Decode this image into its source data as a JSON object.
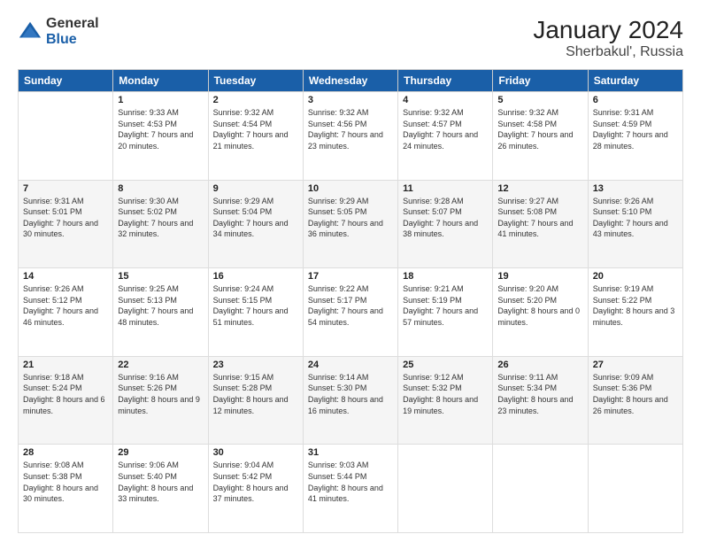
{
  "logo": {
    "general": "General",
    "blue": "Blue"
  },
  "header": {
    "title": "January 2024",
    "subtitle": "Sherbakul', Russia"
  },
  "weekdays": [
    "Sunday",
    "Monday",
    "Tuesday",
    "Wednesday",
    "Thursday",
    "Friday",
    "Saturday"
  ],
  "weeks": [
    [
      {
        "day": "",
        "sunrise": "",
        "sunset": "",
        "daylight": ""
      },
      {
        "day": "1",
        "sunrise": "9:33 AM",
        "sunset": "4:53 PM",
        "daylight": "7 hours and 20 minutes."
      },
      {
        "day": "2",
        "sunrise": "9:32 AM",
        "sunset": "4:54 PM",
        "daylight": "7 hours and 21 minutes."
      },
      {
        "day": "3",
        "sunrise": "9:32 AM",
        "sunset": "4:56 PM",
        "daylight": "7 hours and 23 minutes."
      },
      {
        "day": "4",
        "sunrise": "9:32 AM",
        "sunset": "4:57 PM",
        "daylight": "7 hours and 24 minutes."
      },
      {
        "day": "5",
        "sunrise": "9:32 AM",
        "sunset": "4:58 PM",
        "daylight": "7 hours and 26 minutes."
      },
      {
        "day": "6",
        "sunrise": "9:31 AM",
        "sunset": "4:59 PM",
        "daylight": "7 hours and 28 minutes."
      }
    ],
    [
      {
        "day": "7",
        "sunrise": "9:31 AM",
        "sunset": "5:01 PM",
        "daylight": "7 hours and 30 minutes."
      },
      {
        "day": "8",
        "sunrise": "9:30 AM",
        "sunset": "5:02 PM",
        "daylight": "7 hours and 32 minutes."
      },
      {
        "day": "9",
        "sunrise": "9:29 AM",
        "sunset": "5:04 PM",
        "daylight": "7 hours and 34 minutes."
      },
      {
        "day": "10",
        "sunrise": "9:29 AM",
        "sunset": "5:05 PM",
        "daylight": "7 hours and 36 minutes."
      },
      {
        "day": "11",
        "sunrise": "9:28 AM",
        "sunset": "5:07 PM",
        "daylight": "7 hours and 38 minutes."
      },
      {
        "day": "12",
        "sunrise": "9:27 AM",
        "sunset": "5:08 PM",
        "daylight": "7 hours and 41 minutes."
      },
      {
        "day": "13",
        "sunrise": "9:26 AM",
        "sunset": "5:10 PM",
        "daylight": "7 hours and 43 minutes."
      }
    ],
    [
      {
        "day": "14",
        "sunrise": "9:26 AM",
        "sunset": "5:12 PM",
        "daylight": "7 hours and 46 minutes."
      },
      {
        "day": "15",
        "sunrise": "9:25 AM",
        "sunset": "5:13 PM",
        "daylight": "7 hours and 48 minutes."
      },
      {
        "day": "16",
        "sunrise": "9:24 AM",
        "sunset": "5:15 PM",
        "daylight": "7 hours and 51 minutes."
      },
      {
        "day": "17",
        "sunrise": "9:22 AM",
        "sunset": "5:17 PM",
        "daylight": "7 hours and 54 minutes."
      },
      {
        "day": "18",
        "sunrise": "9:21 AM",
        "sunset": "5:19 PM",
        "daylight": "7 hours and 57 minutes."
      },
      {
        "day": "19",
        "sunrise": "9:20 AM",
        "sunset": "5:20 PM",
        "daylight": "8 hours and 0 minutes."
      },
      {
        "day": "20",
        "sunrise": "9:19 AM",
        "sunset": "5:22 PM",
        "daylight": "8 hours and 3 minutes."
      }
    ],
    [
      {
        "day": "21",
        "sunrise": "9:18 AM",
        "sunset": "5:24 PM",
        "daylight": "8 hours and 6 minutes."
      },
      {
        "day": "22",
        "sunrise": "9:16 AM",
        "sunset": "5:26 PM",
        "daylight": "8 hours and 9 minutes."
      },
      {
        "day": "23",
        "sunrise": "9:15 AM",
        "sunset": "5:28 PM",
        "daylight": "8 hours and 12 minutes."
      },
      {
        "day": "24",
        "sunrise": "9:14 AM",
        "sunset": "5:30 PM",
        "daylight": "8 hours and 16 minutes."
      },
      {
        "day": "25",
        "sunrise": "9:12 AM",
        "sunset": "5:32 PM",
        "daylight": "8 hours and 19 minutes."
      },
      {
        "day": "26",
        "sunrise": "9:11 AM",
        "sunset": "5:34 PM",
        "daylight": "8 hours and 23 minutes."
      },
      {
        "day": "27",
        "sunrise": "9:09 AM",
        "sunset": "5:36 PM",
        "daylight": "8 hours and 26 minutes."
      }
    ],
    [
      {
        "day": "28",
        "sunrise": "9:08 AM",
        "sunset": "5:38 PM",
        "daylight": "8 hours and 30 minutes."
      },
      {
        "day": "29",
        "sunrise": "9:06 AM",
        "sunset": "5:40 PM",
        "daylight": "8 hours and 33 minutes."
      },
      {
        "day": "30",
        "sunrise": "9:04 AM",
        "sunset": "5:42 PM",
        "daylight": "8 hours and 37 minutes."
      },
      {
        "day": "31",
        "sunrise": "9:03 AM",
        "sunset": "5:44 PM",
        "daylight": "8 hours and 41 minutes."
      },
      {
        "day": "",
        "sunrise": "",
        "sunset": "",
        "daylight": ""
      },
      {
        "day": "",
        "sunrise": "",
        "sunset": "",
        "daylight": ""
      },
      {
        "day": "",
        "sunrise": "",
        "sunset": "",
        "daylight": ""
      }
    ]
  ],
  "labels": {
    "sunrise": "Sunrise:",
    "sunset": "Sunset:",
    "daylight": "Daylight:"
  }
}
